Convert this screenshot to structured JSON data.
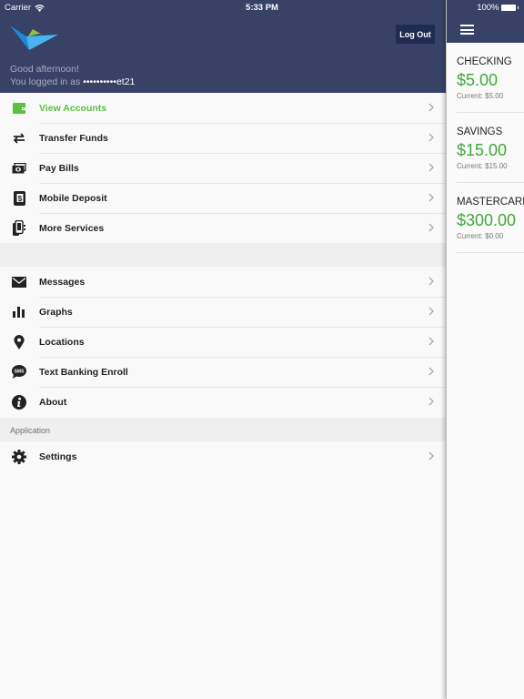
{
  "status_bar": {
    "carrier": "Carrier",
    "time": "5:33 PM",
    "battery": "100%"
  },
  "header": {
    "greeting": "Good afternoon!",
    "logged_in_prefix": "You logged in as",
    "username_masked": "••••••••••et21",
    "logout_label": "Log Out"
  },
  "menu": {
    "primary_items": [
      {
        "label": "View Accounts",
        "icon": "wallet-icon",
        "active": true
      },
      {
        "label": "Transfer Funds",
        "icon": "transfer-arrows-icon",
        "active": false
      },
      {
        "label": "Pay Bills",
        "icon": "cash-icon",
        "active": false
      },
      {
        "label": "Mobile Deposit",
        "icon": "mobile-deposit-icon",
        "active": false
      },
      {
        "label": "More Services",
        "icon": "mobile-services-icon",
        "active": false
      }
    ],
    "secondary_items": [
      {
        "label": "Messages",
        "icon": "envelope-icon"
      },
      {
        "label": "Graphs",
        "icon": "bar-chart-icon"
      },
      {
        "label": "Locations",
        "icon": "map-pin-icon"
      },
      {
        "label": "Text Banking Enroll",
        "icon": "sms-icon"
      },
      {
        "label": "About",
        "icon": "info-icon"
      }
    ],
    "application_section_title": "Application",
    "application_items": [
      {
        "label": "Settings",
        "icon": "gear-icon"
      }
    ]
  },
  "accounts": [
    {
      "name": "CHECKING",
      "balance": "$5.00",
      "current": "Current: $5.00"
    },
    {
      "name": "SAVINGS",
      "balance": "$15.00",
      "current": "Current: $15.00"
    },
    {
      "name": "MASTERCARD",
      "balance": "$300.00",
      "current": "Current: $0.00"
    }
  ],
  "colors": {
    "header_bg": "#374266",
    "logout_bg": "#1e2c52",
    "accent_green": "#5cbf3f",
    "balance_green": "#40a83a"
  }
}
